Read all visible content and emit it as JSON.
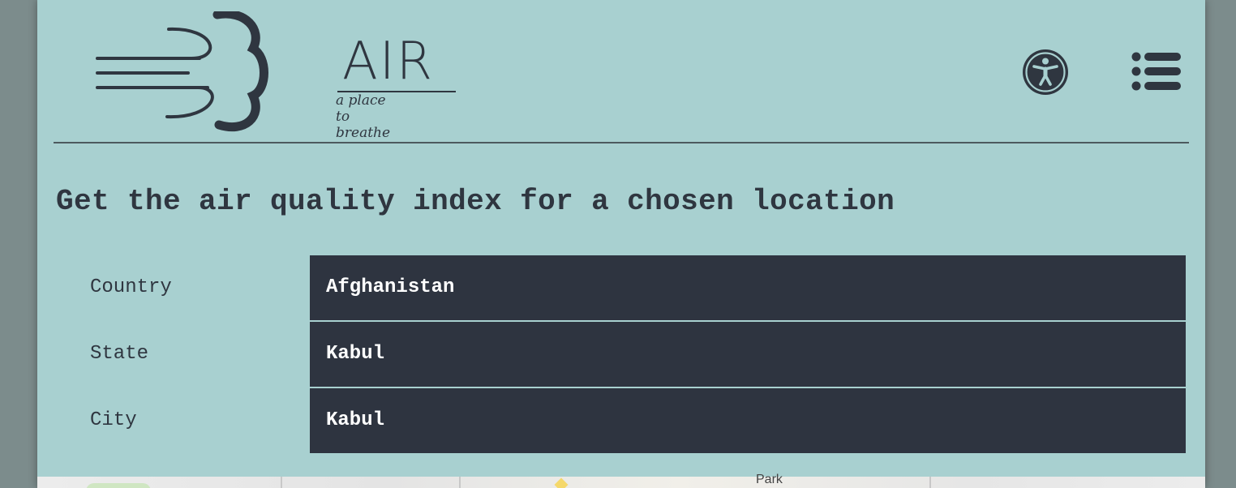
{
  "header": {
    "logo": {
      "wordmark": "AIR",
      "tagline": "a place to breathe",
      "icon": "wind-cloud-logo"
    },
    "accessibility_icon": "accessibility-icon",
    "menu_icon": "hamburger-menu-icon"
  },
  "main": {
    "title": "Get the air quality index for a chosen location",
    "fields": [
      {
        "label": "Country",
        "value": "Afghanistan"
      },
      {
        "label": "State",
        "value": "Kabul"
      },
      {
        "label": "City",
        "value": "Kabul"
      }
    ]
  },
  "map": {
    "visible_label": "Park"
  },
  "colors": {
    "background": "#a8d0d0",
    "dark": "#2e3440",
    "text": "#2f3640",
    "outer": "#7c8c8c"
  }
}
